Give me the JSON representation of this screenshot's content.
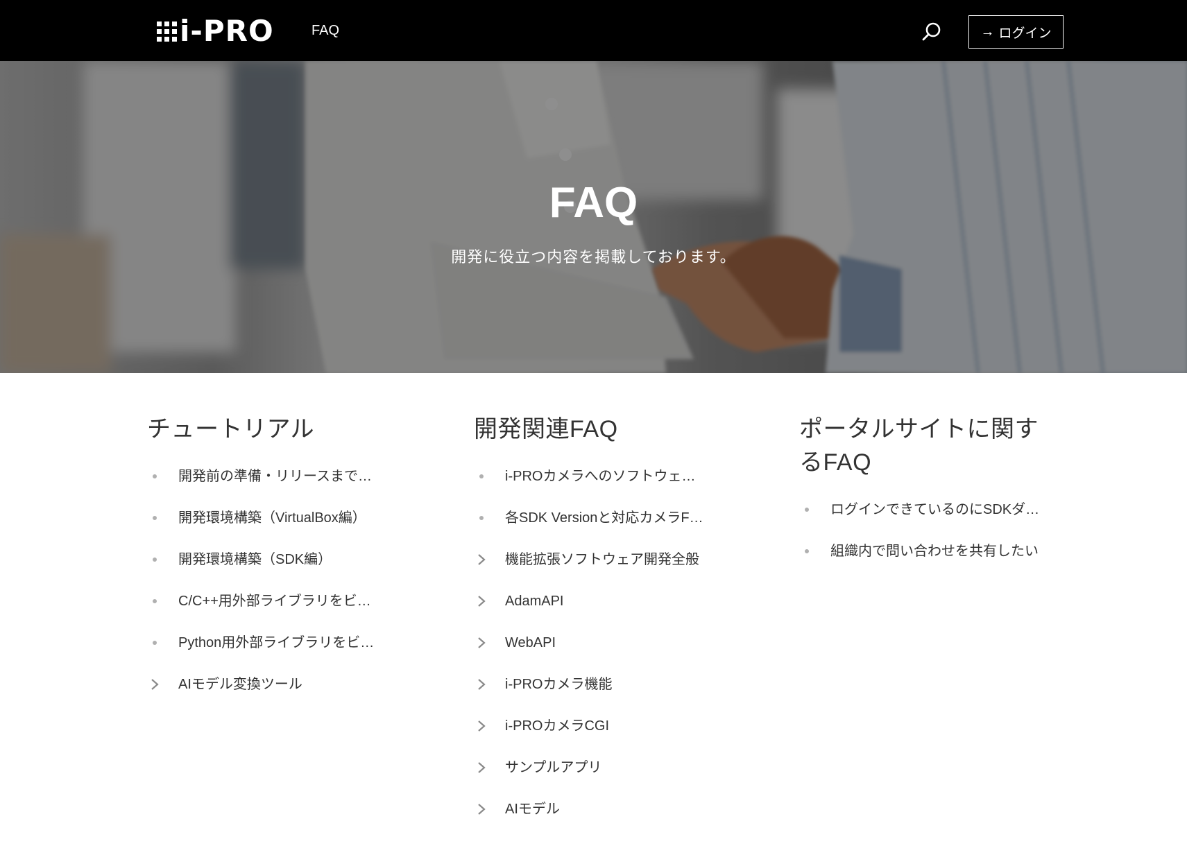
{
  "header": {
    "logo_text": "i-PRO",
    "nav_faq": "FAQ",
    "login_label": "ログイン",
    "icons": [
      "search-icon",
      "arrow-right-icon"
    ]
  },
  "hero": {
    "title": "FAQ",
    "subtitle": "開発に役立つ内容を掲載しております。"
  },
  "columns": [
    {
      "title": "チュートリアル",
      "items": [
        {
          "label": "開発前の準備・リリースまで…",
          "icon": "bullet-dot"
        },
        {
          "label": "開発環境構築（VirtualBox編）",
          "icon": "bullet-dot"
        },
        {
          "label": "開発環境構築（SDK編）",
          "icon": "bullet-dot"
        },
        {
          "label": "C/C++用外部ライブラリをビ…",
          "icon": "bullet-dot"
        },
        {
          "label": "Python用外部ライブラリをビ…",
          "icon": "bullet-dot"
        },
        {
          "label": "AIモデル変換ツール",
          "icon": "chevron-right-icon"
        }
      ]
    },
    {
      "title": "開発関連FAQ",
      "items": [
        {
          "label": "i-PROカメラへのソフトウェ…",
          "icon": "bullet-dot"
        },
        {
          "label": "各SDK Versionと対応カメラF…",
          "icon": "bullet-dot"
        },
        {
          "label": "機能拡張ソフトウェア開発全般",
          "icon": "chevron-right-icon"
        },
        {
          "label": "AdamAPI",
          "icon": "chevron-right-icon"
        },
        {
          "label": "WebAPI",
          "icon": "chevron-right-icon"
        },
        {
          "label": "i-PROカメラ機能",
          "icon": "chevron-right-icon"
        },
        {
          "label": "i-PROカメラCGI",
          "icon": "chevron-right-icon"
        },
        {
          "label": "サンプルアプリ",
          "icon": "chevron-right-icon"
        },
        {
          "label": "AIモデル",
          "icon": "chevron-right-icon"
        }
      ]
    },
    {
      "title": "ポータルサイトに関するFAQ",
      "items": [
        {
          "label": "ログインできているのにSDKダ…",
          "icon": "bullet-dot"
        },
        {
          "label": "組織内で問い合わせを共有したい",
          "icon": "bullet-dot"
        }
      ]
    }
  ]
}
